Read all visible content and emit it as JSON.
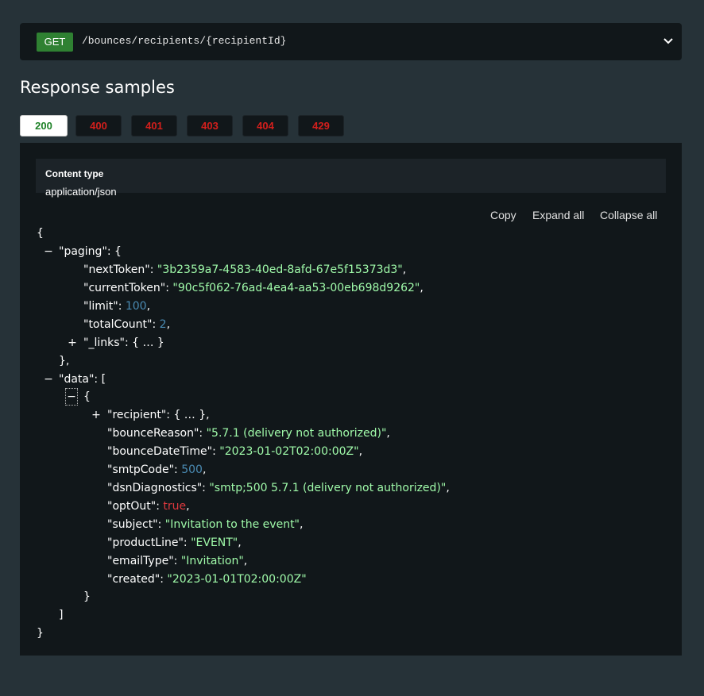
{
  "endpoint": {
    "method": "GET",
    "path": "/bounces/recipients/{recipientId}"
  },
  "section_title": "Response samples",
  "tabs": [
    {
      "label": "200",
      "active": true
    },
    {
      "label": "400"
    },
    {
      "label": "401"
    },
    {
      "label": "403"
    },
    {
      "label": "404"
    },
    {
      "label": "429"
    }
  ],
  "content_type": {
    "label": "Content type",
    "value": "application/json"
  },
  "controls": {
    "copy": "Copy",
    "expand_all": "Expand all",
    "collapse_all": "Collapse all"
  },
  "json_sample": {
    "open_brace": "{",
    "close_brace": "}",
    "paging_key": "\"paging\"",
    "paging_open": ": {",
    "paging_close": "},",
    "next_token_key": "\"nextToken\"",
    "next_token_val": "\"3b2359a7-4583-40ed-8afd-67e5f15373d3\"",
    "current_token_key": "\"currentToken\"",
    "current_token_val": "\"90c5f062-76ad-4ea4-aa53-00eb698d9262\"",
    "limit_key": "\"limit\"",
    "limit_val": "100",
    "total_count_key": "\"totalCount\"",
    "total_count_val": "2",
    "links_key": "\"_links\"",
    "collapsed_obj": ": { … }",
    "data_key": "\"data\"",
    "data_open": ": [",
    "data_close": "]",
    "item_open": "{",
    "item_close": "}",
    "recipient_key": "\"recipient\"",
    "recipient_collapsed": ": { … },",
    "bounce_reason_key": "\"bounceReason\"",
    "bounce_reason_val": "\"5.7.1 (delivery not authorized)\"",
    "bounce_date_key": "\"bounceDateTime\"",
    "bounce_date_val": "\"2023-01-02T02:00:00Z\"",
    "smtp_code_key": "\"smtpCode\"",
    "smtp_code_val": "500",
    "dsn_key": "\"dsnDiagnostics\"",
    "dsn_val": "\"smtp;500 5.7.1 (delivery not authorized)\"",
    "opt_out_key": "\"optOut\"",
    "opt_out_val": "true",
    "subject_key": "\"subject\"",
    "subject_val": "\"Invitation to the event\"",
    "product_line_key": "\"productLine\"",
    "product_line_val": "\"EVENT\"",
    "email_type_key": "\"emailType\"",
    "email_type_val": "\"Invitation\"",
    "created_key": "\"created\"",
    "created_val": "\"2023-01-01T02:00:00Z\"",
    "colon": ": ",
    "comma": ",",
    "minus": "−",
    "plus": "+"
  },
  "colors": {
    "background": "#263238",
    "panel": "#11171a",
    "method_get": "#2f8132",
    "string": "#a0fbaa",
    "number": "#4a8bb3",
    "boolean": "#e0393e",
    "error_tab": "#d41f1c"
  }
}
